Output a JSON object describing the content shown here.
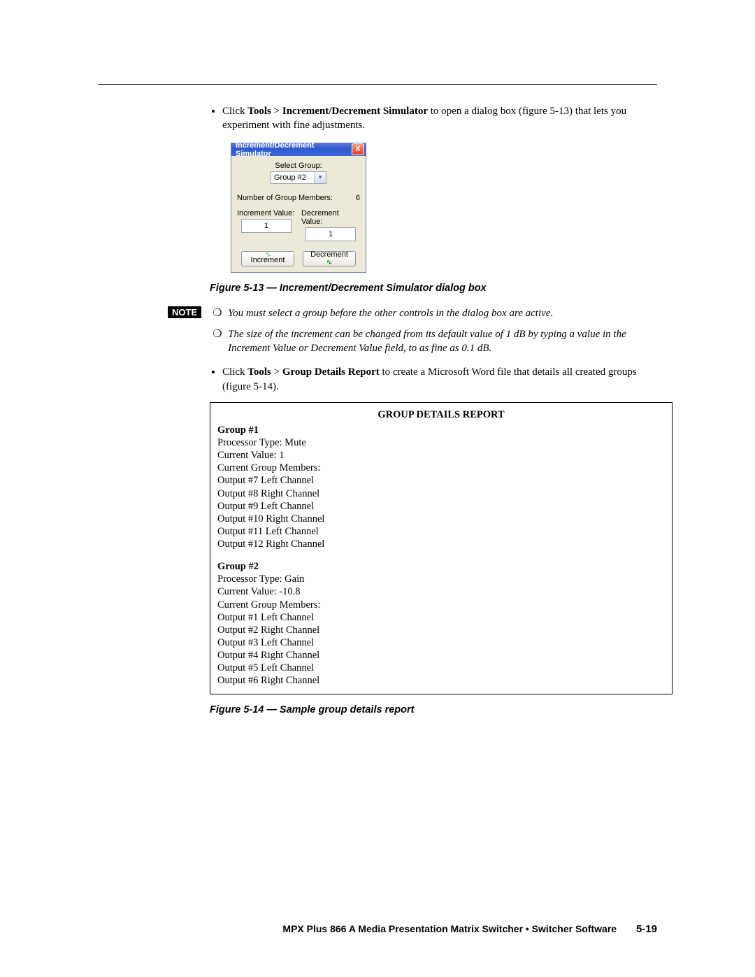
{
  "intro": {
    "bullet1_pre": "Click ",
    "tools1": "Tools",
    "gt1": " > ",
    "sim": "Increment/Decrement Simulator",
    "bullet1_post": " to open a dialog box (figure 5-13) that lets you experiment with fine adjustments."
  },
  "dialog": {
    "title": "Increment/Decrement Simulator",
    "close": "X",
    "select_group_label": "Select Group:",
    "group_value": "Group #2",
    "members_label": "Number of Group Members:",
    "members_value": "6",
    "inc_label": "Increment Value:",
    "inc_value": "1",
    "dec_label": "Decrement Value:",
    "dec_value": "1",
    "inc_btn": "Increment",
    "dec_btn": "Decrement"
  },
  "caption1": "Figure 5-13 — Increment/Decrement Simulator dialog box",
  "note": {
    "tag": "NOTE",
    "item1": "You must select a group before the other controls in the dialog box are active.",
    "item2": "The size of the increment can be changed from its default value of 1 dB by typing a value in the Increment Value or Decrement Value field, to as fine as 0.1 dB."
  },
  "bullet2": {
    "pre": "Click ",
    "tools": "Tools",
    "gt": " > ",
    "rep": "Group Details Report",
    "post": " to create a Microsoft Word file that details all created groups (figure 5-14)."
  },
  "report": {
    "title": "GROUP DETAILS REPORT",
    "g1": {
      "head": "Group #1",
      "lines": [
        "Processor Type: Mute",
        "Current Value: 1",
        "Current Group Members:",
        "Output #7 Left Channel",
        "Output #8 Right Channel",
        "Output #9 Left Channel",
        "Output #10 Right Channel",
        "Output #11 Left Channel",
        "Output #12 Right Channel"
      ]
    },
    "g2": {
      "head": "Group #2",
      "lines": [
        "Processor Type: Gain",
        "Current Value: -10.8",
        "Current Group Members:",
        "Output #1 Left Channel",
        "Output #2 Right Channel",
        "Output #3 Left Channel",
        "Output #4 Right Channel",
        "Output #5 Left Channel",
        "Output #6 Right Channel"
      ]
    }
  },
  "caption2": "Figure 5-14 — Sample group details report",
  "footer": {
    "text": "MPX Plus 866 A Media Presentation Matrix Switcher • Switcher Software",
    "page": "5-19"
  }
}
